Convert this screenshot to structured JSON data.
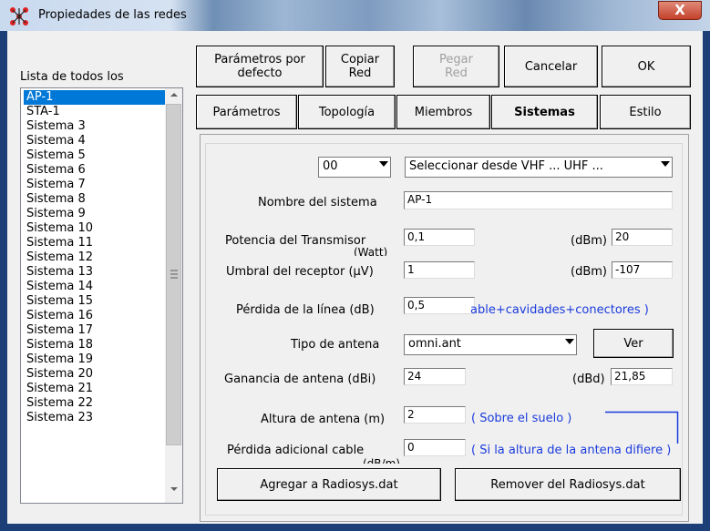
{
  "window": {
    "title": "Propiedades de las redes",
    "close_label": "X"
  },
  "toolbar": {
    "defaults_label": "Parámetros por\ndefecto",
    "copy_label": "Copiar\nRed",
    "paste_label": "Pegar\nRed",
    "cancel_label": "Cancelar",
    "ok_label": "OK"
  },
  "list": {
    "label": "Lista de todos los",
    "items": [
      "AP-1",
      "STA-1",
      "Sistema  3",
      "Sistema  4",
      "Sistema  5",
      "Sistema  6",
      "Sistema  7",
      "Sistema  8",
      "Sistema  9",
      "Sistema 10",
      "Sistema 11",
      "Sistema 12",
      "Sistema 13",
      "Sistema 14",
      "Sistema 15",
      "Sistema 16",
      "Sistema 17",
      "Sistema 18",
      "Sistema 19",
      "Sistema 20",
      "Sistema 21",
      "Sistema 22",
      "Sistema 23"
    ],
    "selected": "AP-1"
  },
  "tabs": [
    {
      "label": "Parámetros"
    },
    {
      "label": "Topología"
    },
    {
      "label": "Miembros"
    },
    {
      "label": "Sistemas",
      "active": true
    },
    {
      "label": "Estilo"
    }
  ],
  "form": {
    "index_value": "00",
    "select_value": "Seleccionar desde VHF ... UHF ...",
    "system_name_label": "Nombre del sistema",
    "system_name_value": "AP-1",
    "tx_power_label": "Potencia del Transmisor",
    "tx_power_unit": "(Watt)",
    "tx_power_value": "0,1",
    "tx_dbm_label": "(dBm)",
    "tx_dbm_value": "20",
    "rx_threshold_label": "Umbral del receptor (µV)",
    "rx_threshold_value": "1",
    "rx_dbm_label": "(dBm)",
    "rx_dbm_value": "-107",
    "line_loss_label": "Pérdida de la línea (dB)",
    "line_loss_value": "0,5",
    "line_loss_note": "able+cavidades+conectores )",
    "antenna_type_label": "Tipo de antena",
    "antenna_type_value": "omni.ant",
    "view_label": "Ver",
    "gain_label": "Ganancia de antena (dBi)",
    "gain_value": "24",
    "gain_dbd_label": "(dBd)",
    "gain_dbd_value": "21,85",
    "height_label": "Altura de antena (m)",
    "height_value": "2",
    "height_note": "( Sobre el suelo )",
    "extra_loss_label": "Pérdida adicional cable",
    "extra_loss_unit": "(dB/m)",
    "extra_loss_value": "0",
    "extra_loss_note": "( Si la altura de la antena difiere )",
    "add_label": "Agregar a Radiosys.dat",
    "remove_label": "Remover del Radiosys.dat"
  },
  "colors": {
    "selection": "#0078d7",
    "note_text": "#1a3bdc",
    "frame": "#1d3f78"
  }
}
